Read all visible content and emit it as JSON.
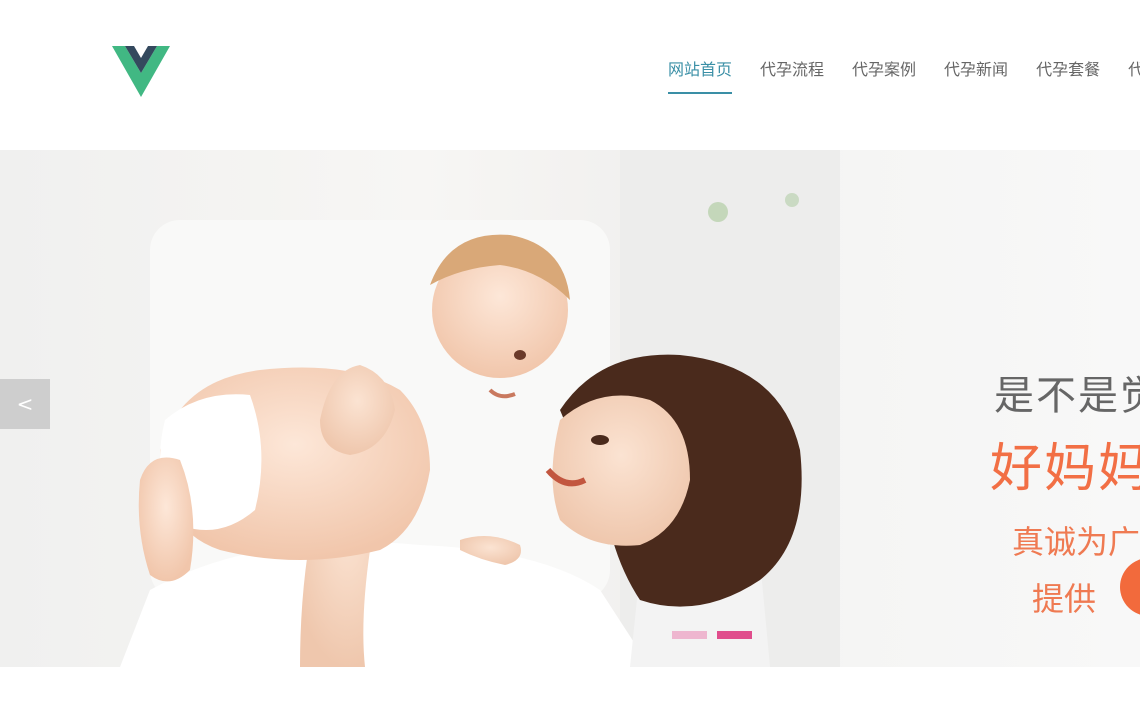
{
  "header": {
    "logo_name": "vue-logo",
    "nav": [
      {
        "label": "网站首页",
        "active": true
      },
      {
        "label": "代孕流程",
        "active": false
      },
      {
        "label": "代孕案例",
        "active": false
      },
      {
        "label": "代孕新闻",
        "active": false
      },
      {
        "label": "代孕套餐",
        "active": false
      },
      {
        "label": "代",
        "active": false
      }
    ]
  },
  "banner": {
    "prev_label": "<",
    "tagline_1": "是不是觉",
    "tagline_2": "好妈妈",
    "tagline_3": "真诚为广",
    "tagline_4": "提供",
    "slide_count": 2,
    "active_slide": 2
  },
  "colors": {
    "accent": "#3a8fa6",
    "nav_text": "#666666",
    "highlight_orange": "#f26f45",
    "dot_active": "#e04d8c",
    "dot_inactive": "#eeb6cf",
    "logo_green": "#41b883",
    "logo_dark": "#34495e"
  }
}
